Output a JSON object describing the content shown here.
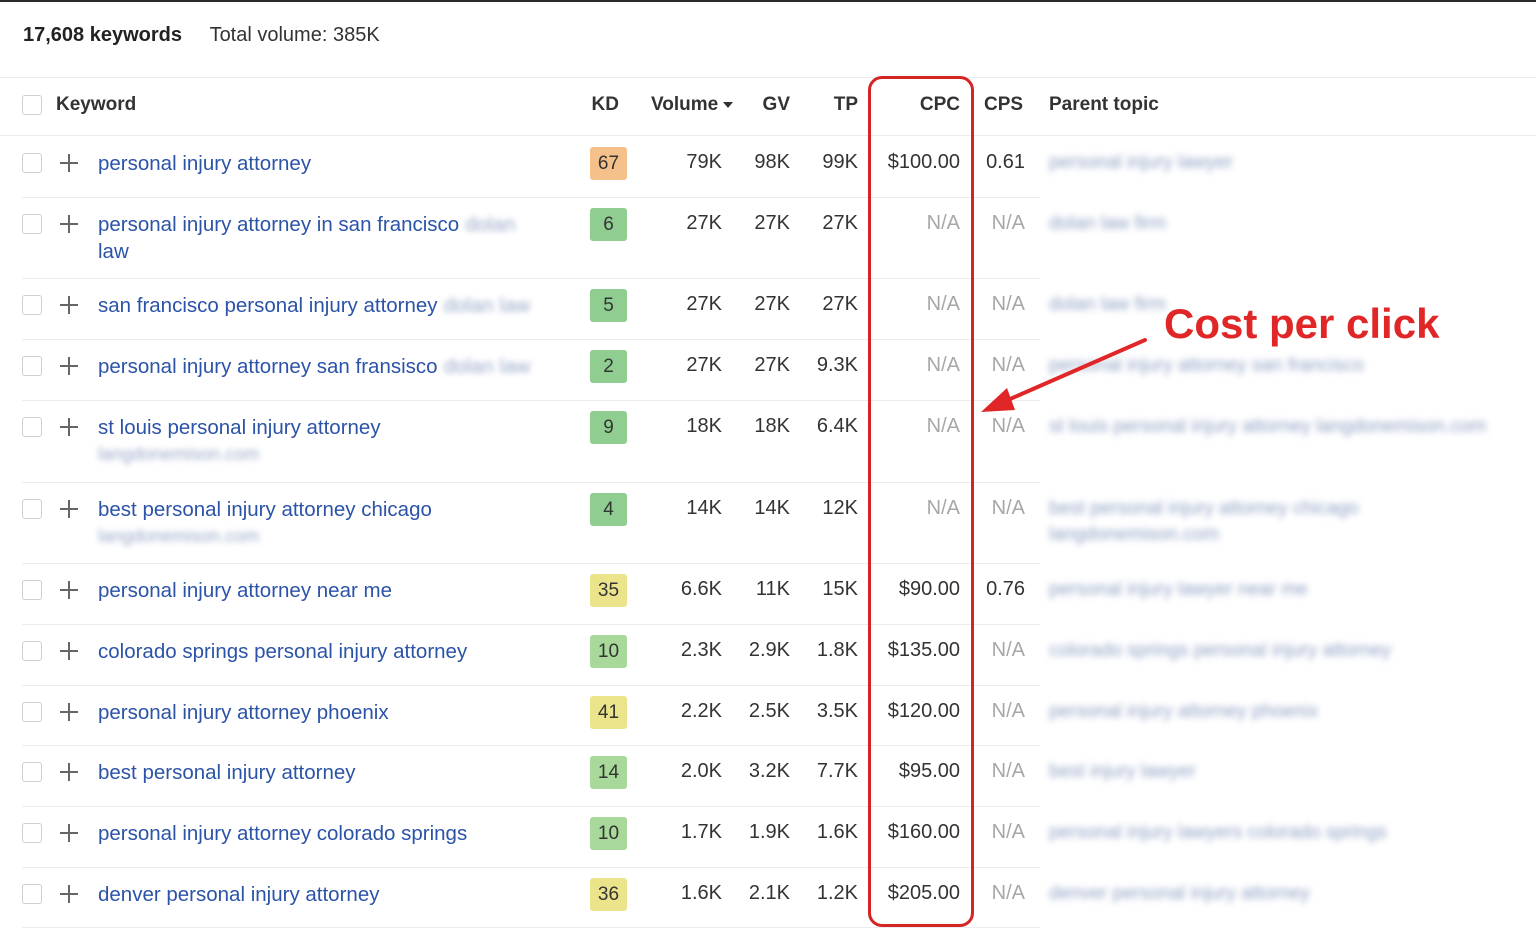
{
  "summary": {
    "keyword_count": "17,608 keywords",
    "total_volume": "Total volume: 385K"
  },
  "columns": {
    "keyword": "Keyword",
    "kd": "KD",
    "volume": "Volume",
    "gv": "GV",
    "tp": "TP",
    "cpc": "CPC",
    "cps": "CPS",
    "parent_topic": "Parent topic"
  },
  "rows": [
    {
      "keyword": "personal injury attorney",
      "keyword_extra": "",
      "keyword_sub": "",
      "kd": "67",
      "kd_color": "#f5c08a",
      "volume": "79K",
      "gv": "98K",
      "tp": "99K",
      "cpc": "$100.00",
      "cps": "0.61",
      "parent_topic": "personal injury lawyer"
    },
    {
      "keyword": "personal injury attorney in san francisco",
      "keyword_extra": "dolan",
      "keyword_sub": "law",
      "kd": "6",
      "kd_color": "#8fce90",
      "volume": "27K",
      "gv": "27K",
      "tp": "27K",
      "cpc": "N/A",
      "cps": "N/A",
      "parent_topic": "dolan law firm"
    },
    {
      "keyword": "san francisco personal injury attorney",
      "keyword_extra": "dolan law",
      "keyword_sub": "",
      "kd": "5",
      "kd_color": "#8fce90",
      "volume": "27K",
      "gv": "27K",
      "tp": "27K",
      "cpc": "N/A",
      "cps": "N/A",
      "parent_topic": "dolan law firm"
    },
    {
      "keyword": "personal injury attorney san fransisco",
      "keyword_extra": "dolan law",
      "keyword_sub": "",
      "kd": "2",
      "kd_color": "#8fce90",
      "volume": "27K",
      "gv": "27K",
      "tp": "9.3K",
      "cpc": "N/A",
      "cps": "N/A",
      "parent_topic": "personal injury attorney san francisco"
    },
    {
      "keyword": "st louis personal injury attorney",
      "keyword_extra": "",
      "keyword_sub": "langdonemison.com",
      "kd": "9",
      "kd_color": "#8fce90",
      "volume": "18K",
      "gv": "18K",
      "tp": "6.4K",
      "cpc": "N/A",
      "cps": "N/A",
      "parent_topic": "st louis personal injury attorney langdonemison.com"
    },
    {
      "keyword": "best personal injury attorney chicago",
      "keyword_extra": "",
      "keyword_sub": "langdonemison.com",
      "kd": "4",
      "kd_color": "#8fce90",
      "volume": "14K",
      "gv": "14K",
      "tp": "12K",
      "cpc": "N/A",
      "cps": "N/A",
      "parent_topic": "best personal injury attorney chicago langdonemison.com"
    },
    {
      "keyword": "personal injury attorney near me",
      "keyword_extra": "",
      "keyword_sub": "",
      "kd": "35",
      "kd_color": "#ece48a",
      "volume": "6.6K",
      "gv": "11K",
      "tp": "15K",
      "cpc": "$90.00",
      "cps": "0.76",
      "parent_topic": "personal injury lawyer near me"
    },
    {
      "keyword": "colorado springs personal injury attorney",
      "keyword_extra": "",
      "keyword_sub": "",
      "kd": "10",
      "kd_color": "#a8d99a",
      "volume": "2.3K",
      "gv": "2.9K",
      "tp": "1.8K",
      "cpc": "$135.00",
      "cps": "N/A",
      "parent_topic": "colorado springs personal injury attorney"
    },
    {
      "keyword": "personal injury attorney phoenix",
      "keyword_extra": "",
      "keyword_sub": "",
      "kd": "41",
      "kd_color": "#ece48a",
      "volume": "2.2K",
      "gv": "2.5K",
      "tp": "3.5K",
      "cpc": "$120.00",
      "cps": "N/A",
      "parent_topic": "personal injury attorney phoenix"
    },
    {
      "keyword": "best personal injury attorney",
      "keyword_extra": "",
      "keyword_sub": "",
      "kd": "14",
      "kd_color": "#a8d99a",
      "volume": "2.0K",
      "gv": "3.2K",
      "tp": "7.7K",
      "cpc": "$95.00",
      "cps": "N/A",
      "parent_topic": "best injury lawyer"
    },
    {
      "keyword": "personal injury attorney colorado springs",
      "keyword_extra": "",
      "keyword_sub": "",
      "kd": "10",
      "kd_color": "#a8d99a",
      "volume": "1.7K",
      "gv": "1.9K",
      "tp": "1.6K",
      "cpc": "$160.00",
      "cps": "N/A",
      "parent_topic": "personal injury lawyers colorado springs"
    },
    {
      "keyword": "denver personal injury attorney",
      "keyword_extra": "",
      "keyword_sub": "",
      "kd": "36",
      "kd_color": "#ece48a",
      "volume": "1.6K",
      "gv": "2.1K",
      "tp": "1.2K",
      "cpc": "$205.00",
      "cps": "N/A",
      "parent_topic": "denver personal injury attorney"
    }
  ],
  "annotation": {
    "label": "Cost per click",
    "color": "#e02626"
  },
  "colors": {
    "link": "#2b53a8",
    "annotation_red": "#d42424"
  }
}
